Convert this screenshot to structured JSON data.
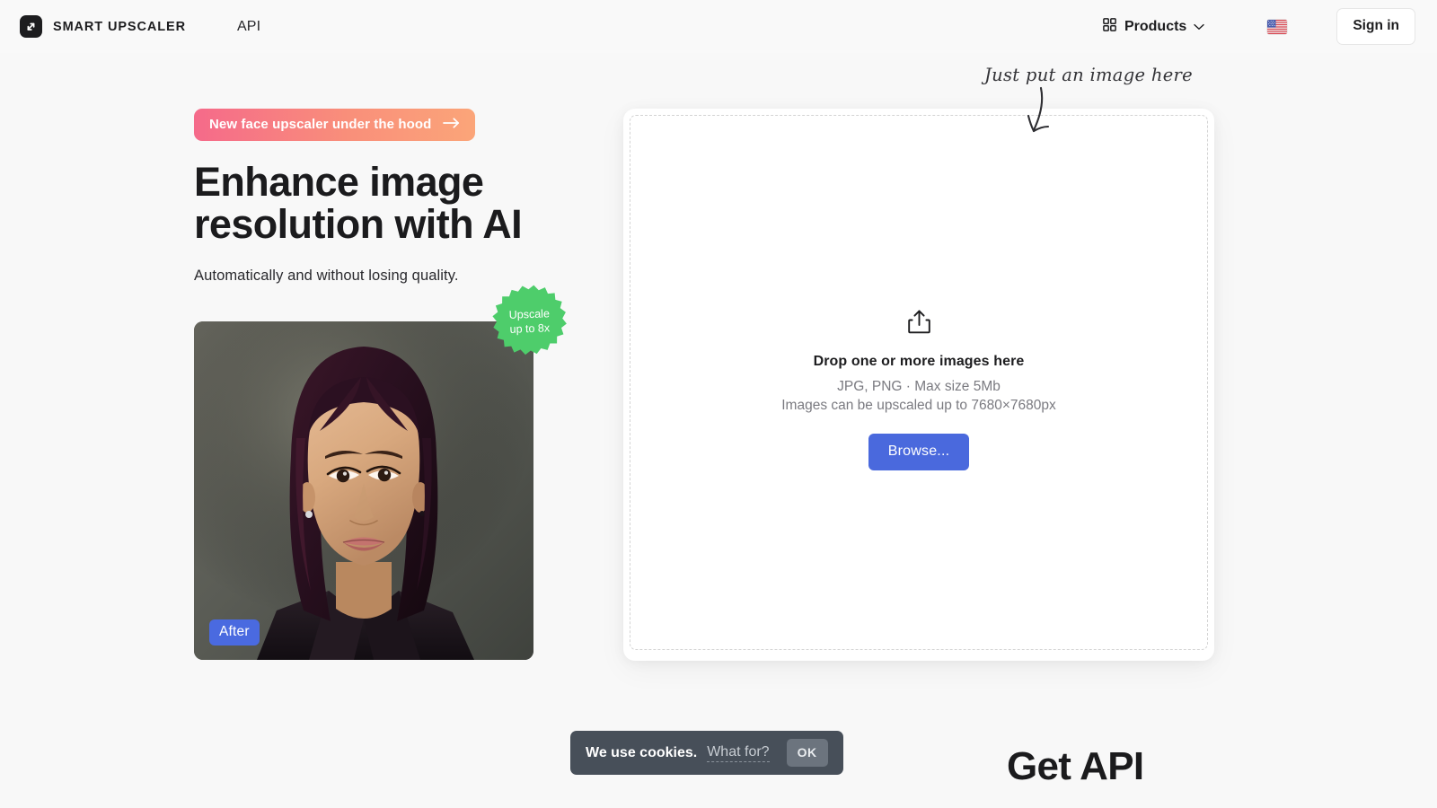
{
  "header": {
    "brand_name": "SMART UPSCALER",
    "brand_icon": "expand-arrow-icon",
    "nav_api_label": "API",
    "products_label": "Products",
    "products_icon": "grid-icon",
    "products_chevron": "chevron-down-icon",
    "language_flag": "us-flag-icon",
    "signin_label": "Sign in"
  },
  "hero": {
    "promo_label": "New face upscaler under the hood",
    "promo_arrow": "arrow-right-icon",
    "headline": "Enhance image resolution with AI",
    "subline": "Automatically and without losing quality.",
    "photo_after_label": "After",
    "upsell_line1": "Upscale",
    "upsell_line2": "up to 8x"
  },
  "dropzone": {
    "upload_icon": "upload-share-icon",
    "title": "Drop one or more images here",
    "formats": "JPG, PNG · Max size 5Mb",
    "limits": "Images can be upscaled up to 7680×7680px",
    "browse_label": "Browse..."
  },
  "annotation": {
    "text": "Just put an image here",
    "arrow_icon": "hand-drawn-arrow-down-icon"
  },
  "cookies": {
    "message": "We use cookies.",
    "link_label": "What for?",
    "ok_label": "OK"
  },
  "footer": {
    "get_api_heading": "Get API"
  },
  "colors": {
    "page_background": "#f8f8f8",
    "accent_blue": "#4a69dd",
    "badge_green": "#4ecd6b",
    "promo_gradient_start": "#f56a8a",
    "promo_gradient_end": "#fba579",
    "cookie_bar": "#474f59",
    "text_primary": "#1d1d1f"
  }
}
